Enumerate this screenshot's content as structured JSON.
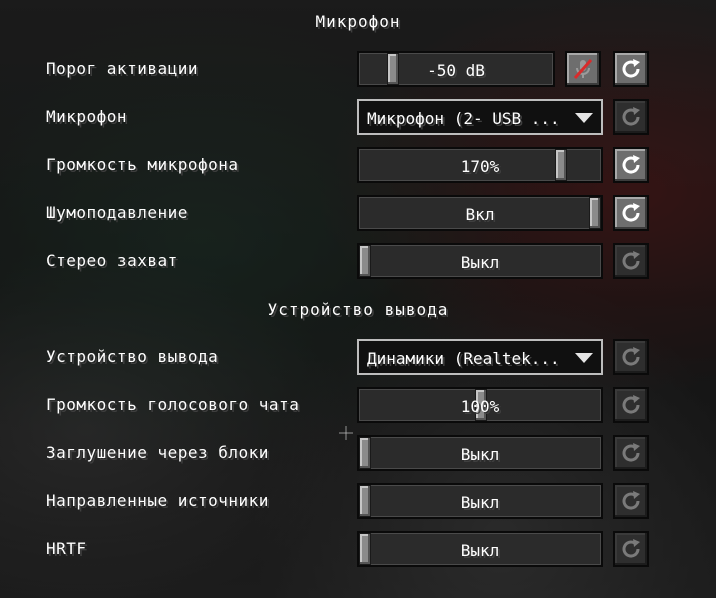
{
  "sections": {
    "microphone_title": "Микрофон",
    "output_title": "Устройство вывода"
  },
  "rows": {
    "activation_threshold": {
      "label": "Порог активации",
      "value": "-50 dB",
      "slider_fraction": 0.15
    },
    "microphone": {
      "label": "Микрофон",
      "value": "Микрофон (2- USB ..."
    },
    "mic_volume": {
      "label": "Громкость микрофона",
      "value": "170%",
      "slider_fraction": 0.85
    },
    "noise_suppression": {
      "label": "Шумоподавление",
      "value": "Вкл",
      "state": "on"
    },
    "stereo_capture": {
      "label": "Стерео захват",
      "value": "Выкл",
      "state": "off"
    },
    "output_device": {
      "label": "Устройство вывода",
      "value": "Динамики (Realtek..."
    },
    "voice_volume": {
      "label": "Громкость голосового чата",
      "value": "100%",
      "slider_fraction": 0.5
    },
    "block_occlusion": {
      "label": "Заглушение через блоки",
      "value": "Выкл",
      "state": "off"
    },
    "directional_sources": {
      "label": "Направленные источники",
      "value": "Выкл",
      "state": "off"
    },
    "hrtf": {
      "label": "HRTF",
      "value": "Выкл",
      "state": "off"
    }
  },
  "icons": {
    "reset": "reset-icon",
    "mute": "muted-microphone-icon",
    "dropdown": "chevron-down-icon"
  },
  "colors": {
    "text": "#ffffff",
    "control_bg": "#2b2b2b",
    "button_active": "#6e6e6e",
    "button_disabled": "#2e2e2e",
    "mute_icon": "#d92b2b"
  }
}
